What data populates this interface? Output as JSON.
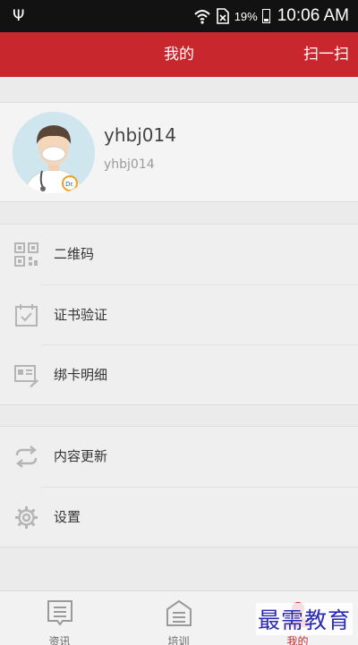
{
  "status_bar": {
    "usb_icon": "usb-icon",
    "battery_percent": "19%",
    "time": "10:06 AM"
  },
  "header": {
    "title": "我的",
    "scan_label": "扫一扫",
    "color": "#c8282d"
  },
  "profile": {
    "username": "yhbj014",
    "user_id": "yhbj014",
    "avatar_icon": "doctor-avatar"
  },
  "menu_group_1": [
    {
      "label": "二维码",
      "icon": "qr-code-icon"
    },
    {
      "label": "证书验证",
      "icon": "calendar-check-icon"
    },
    {
      "label": "绑卡明细",
      "icon": "card-icon"
    }
  ],
  "menu_group_2": [
    {
      "label": "内容更新",
      "icon": "refresh-icon"
    },
    {
      "label": "设置",
      "icon": "gear-icon"
    }
  ],
  "tabs": [
    {
      "label": "资讯",
      "icon": "news-icon"
    },
    {
      "label": "培训",
      "icon": "training-icon"
    },
    {
      "label": "我的",
      "icon": "person-icon",
      "active": true
    }
  ],
  "watermark": "最需教育"
}
